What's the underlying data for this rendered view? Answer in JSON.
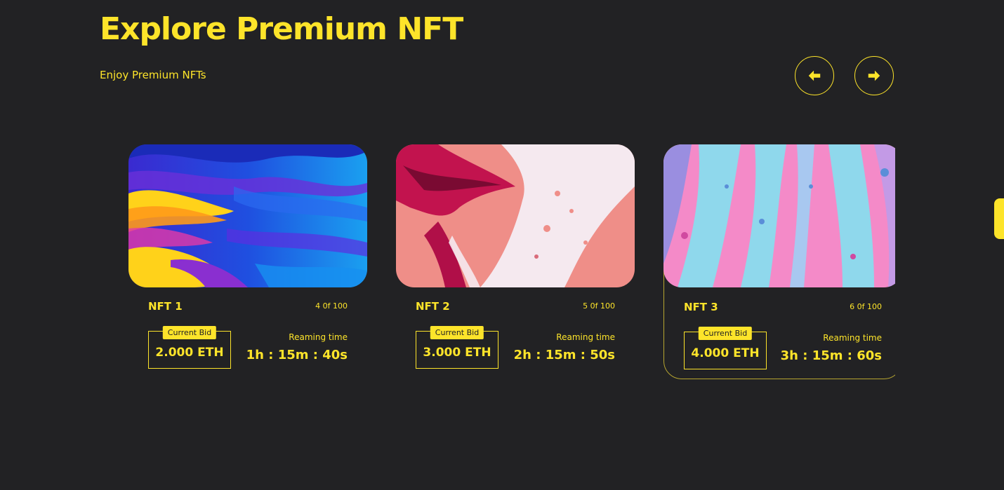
{
  "header": {
    "title": "Explore Premium NFT",
    "subtitle": "Enjoy Premium NFTs"
  },
  "navigation": {
    "prev_icon": "arrow-left-icon",
    "next_icon": "arrow-right-icon"
  },
  "colors": {
    "accent": "#fde42a",
    "background": "#222224"
  },
  "cards": [
    {
      "name": "NFT 1",
      "edition": "4 0f 100",
      "bid_label": "Current Bid",
      "bid_value": "2.000 ETH",
      "time_label": "Reaming time",
      "time_value": "1h : 15m : 40s"
    },
    {
      "name": "NFT 2",
      "edition": "5 0f 100",
      "bid_label": "Current Bid",
      "bid_value": "3.000 ETH",
      "time_label": "Reaming time",
      "time_value": "2h : 15m : 50s"
    },
    {
      "name": "NFT 3",
      "edition": "6 0f 100",
      "bid_label": "Current Bid",
      "bid_value": "4.000 ETH",
      "time_label": "Reaming time",
      "time_value": "3h : 15m : 60s"
    }
  ]
}
